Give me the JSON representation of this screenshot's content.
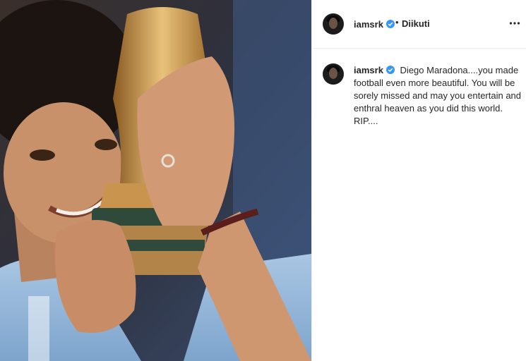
{
  "header": {
    "username": "iamsrk",
    "separator": "•",
    "follow_label": "Diikuti"
  },
  "caption": {
    "username": "iamsrk",
    "text": "Diego Maradona....you made football even more beautiful. You will be sorely missed and may you entertain and enthral heaven as you did this world. RIP...."
  },
  "colors": {
    "verified_badge": "#3897f0",
    "text": "#262626",
    "divider": "#efefef"
  },
  "icons": [
    "verified-badge-icon",
    "more-options-icon"
  ]
}
